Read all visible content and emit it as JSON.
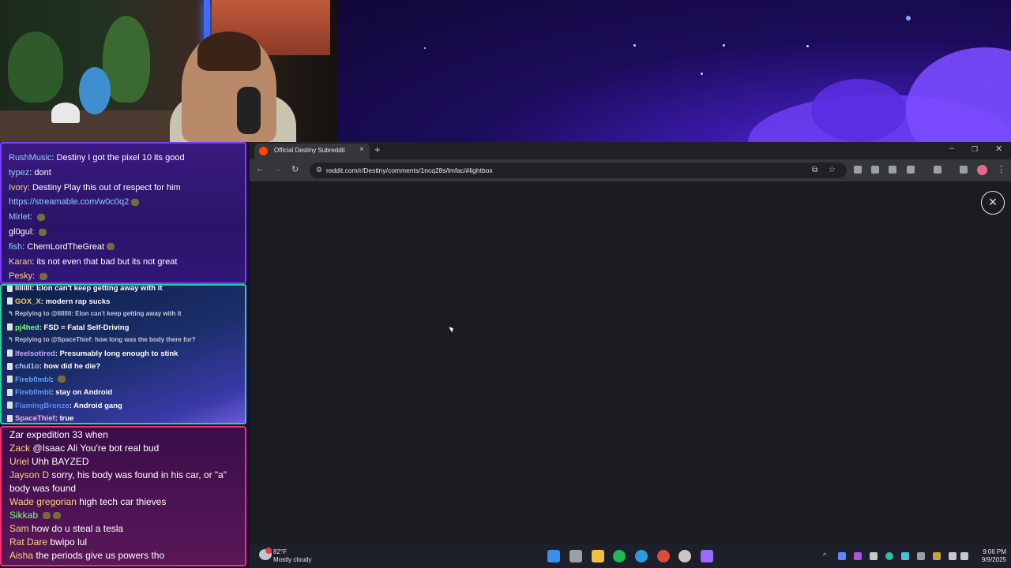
{
  "chat_top": {
    "messages": [
      {
        "user": "RushMusic",
        "text": "Destiny I got the pixel 10 its good",
        "color": "#8fd0ff"
      },
      {
        "user": "typez",
        "text": "dont",
        "color": "#8fd0ff"
      },
      {
        "user": "Ivory",
        "text": "Destiny Play this out of respect for him",
        "color": "#ffd27a"
      },
      {
        "user": "",
        "text": "https://streamable.com/w0c0q2",
        "color": "#8fd0ff"
      },
      {
        "user": "Mirlet",
        "text": "",
        "color": "#8fd0ff"
      },
      {
        "user": "gl0gul",
        "text": "",
        "color": "#ffffff"
      },
      {
        "user": "fish",
        "text": "ChemLordTheGreat",
        "color": "#8fd0ff"
      },
      {
        "user": "Karan",
        "text": "its not even that bad but its not great",
        "color": "#ffd27a"
      },
      {
        "user": "Pesky",
        "text": "",
        "color": "#ffd27a"
      }
    ]
  },
  "chat_mid": {
    "messages": [
      {
        "kind": "msg",
        "user": "llllllll",
        "text": "Elon can't keep getting away with it",
        "color": "#ffffff"
      },
      {
        "kind": "msg",
        "user": "GOX_X",
        "text": "modern rap sucks",
        "color": "#ffd24a"
      },
      {
        "kind": "reply",
        "text": "Replying to @llllllll: Elon can't keep getting away with it"
      },
      {
        "kind": "msg",
        "user": "pj4hed",
        "text": "FSD = Fatal Self-Driving",
        "color": "#7aff7a"
      },
      {
        "kind": "reply",
        "text": "Replying to @SpaceThief: how long was the body there for?"
      },
      {
        "kind": "msg",
        "user": "lfeelsotired",
        "text": "Presumably long enough to stink",
        "color": "#c8a8ff"
      },
      {
        "kind": "msg",
        "user": "chul1o",
        "text": "how did he die?",
        "color": "#a8c8ff"
      },
      {
        "kind": "msg",
        "user": "Fireb0mbl",
        "text": "",
        "color": "#5aa0ff"
      },
      {
        "kind": "msg",
        "user": "Fireb0mbl",
        "text": "stay on Android",
        "color": "#5aa0ff"
      },
      {
        "kind": "msg",
        "user": "FlamingBronze",
        "text": "Android gang",
        "color": "#5a8aff"
      },
      {
        "kind": "msg",
        "user": "SpaceThief",
        "text": "true",
        "color": "#ffb0e0"
      }
    ]
  },
  "chat_bottom": {
    "messages": [
      {
        "user": "Zar",
        "text": "expedition 33 when",
        "color": "#ffffff"
      },
      {
        "user": "Zack",
        "text": "@Isaac Ali You're bot real bud",
        "color": "#ffd27a"
      },
      {
        "user": "Uriel",
        "text": " Uhh BAYZED",
        "color": "#ffd27a"
      },
      {
        "user": "Jayson D",
        "text": "sorry, his body was found in his car, or \"a\"",
        "color": "#ffd27a"
      },
      {
        "user": "",
        "text": "body was found",
        "color": "#ffffff"
      },
      {
        "user": "Wade gregorian",
        "text": "high tech car thieves",
        "color": "#ffd27a"
      },
      {
        "user": "Sikkab",
        "text": "",
        "color": "#7aff7a"
      },
      {
        "user": "Sam",
        "text": "how do u steal a tesla",
        "color": "#ffd27a"
      },
      {
        "user": "Rat Dare",
        "text": "bwipo lul",
        "color": "#ffd27a"
      },
      {
        "user": "Aisha",
        "text": "the periods give us powers tho",
        "color": "#ffd27a"
      }
    ]
  },
  "browser": {
    "tab_title": "Official Destiny Subreddit",
    "tab_close": "×",
    "new_tab": "+",
    "url": "reddit.com/r/Destiny/comments/1ncq28s/lmfac/#lightbox",
    "lightbox_close": "×",
    "window_minimize": "–",
    "window_restore": "❐",
    "window_close": "✕",
    "back": "←",
    "forward": "→",
    "reload": "↻",
    "bookmark": "☆",
    "menu": "⋮"
  },
  "taskbar": {
    "weather_temp": "82°F",
    "weather_desc": "Mostly cloudy",
    "time": "9:06 PM",
    "date": "9/9/2025",
    "accent": "#1d1f2b"
  }
}
